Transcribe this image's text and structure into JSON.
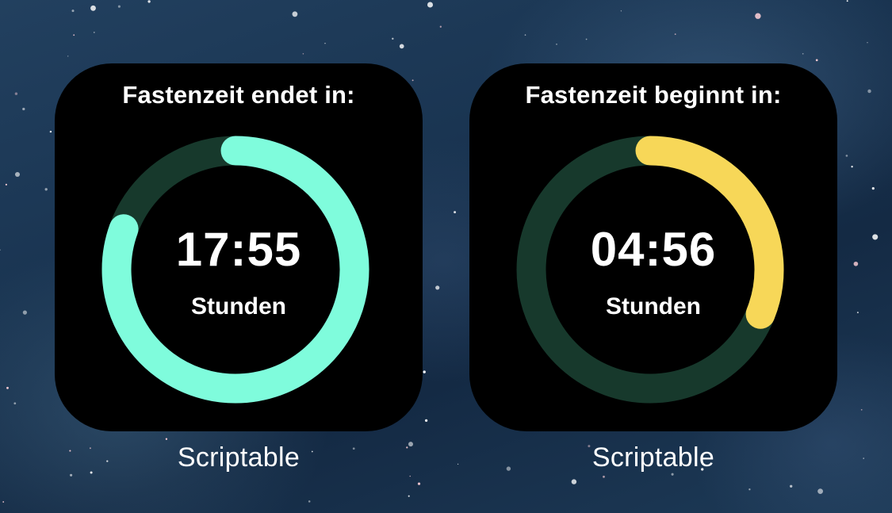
{
  "widgets": [
    {
      "title": "Fastenzeit endet in:",
      "time": "17:55",
      "unit": "Stunden",
      "app_name": "Scriptable",
      "progress_color": "#7ffcdc",
      "track_color": "#17392c",
      "arc": {
        "start_deg": 0,
        "end_deg": 290
      }
    },
    {
      "title": "Fastenzeit beginnt in:",
      "time": "04:56",
      "unit": "Stunden",
      "app_name": "Scriptable",
      "progress_color": "#f7d758",
      "track_color": "#17392c",
      "arc": {
        "start_deg": 0,
        "end_deg": 112
      }
    }
  ]
}
